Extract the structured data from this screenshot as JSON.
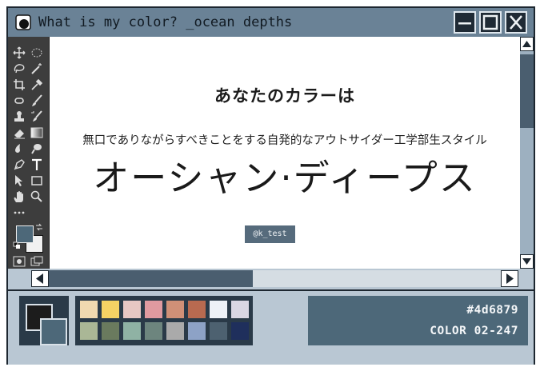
{
  "window": {
    "title": "What is my color? _ocean depths",
    "title_icon": "app-logo-icon",
    "buttons": [
      "minimize-icon",
      "maximize-icon",
      "close-icon"
    ]
  },
  "toolbox": {
    "tools": [
      "move-icon",
      "marquee-icon",
      "lasso-icon",
      "magic-wand-icon",
      "crop-icon",
      "eyedropper-icon",
      "healing-icon",
      "brush-icon",
      "stamp-icon",
      "history-brush-icon",
      "eraser-icon",
      "gradient-icon",
      "blur-icon",
      "dodge-icon",
      "pen-icon",
      "type-icon",
      "path-select-icon",
      "rectangle-icon",
      "hand-icon",
      "zoom-icon",
      "more-icon",
      "swap-colors-icon",
      "default-colors-icon",
      "quick-mask-icon",
      "screen-mode-icon"
    ]
  },
  "canvas": {
    "heading": "あなたのカラーは",
    "subtitle": "無口でありながらすべきことをする自発的なアウトサイダー工学部生スタイル",
    "color_name": "オーシャン·ディープス",
    "handle": "@k_test"
  },
  "palette": {
    "foreground": "#1c1c1c",
    "background": "#4d6879",
    "swatches": [
      "#f0d9b0",
      "#f5d264",
      "#e7c7c3",
      "#e09aa0",
      "#d09077",
      "#b86a50",
      "#eef2f7",
      "#d9d6e3",
      "#aab796",
      "#6a7a5e",
      "#8fb2a4",
      "#6d857e",
      "#aaaaaa",
      "#8da2c6",
      "#4d6170",
      "#1f2f5c"
    ]
  },
  "info": {
    "hex": "#4d6879",
    "code": "COLOR 02-247"
  }
}
